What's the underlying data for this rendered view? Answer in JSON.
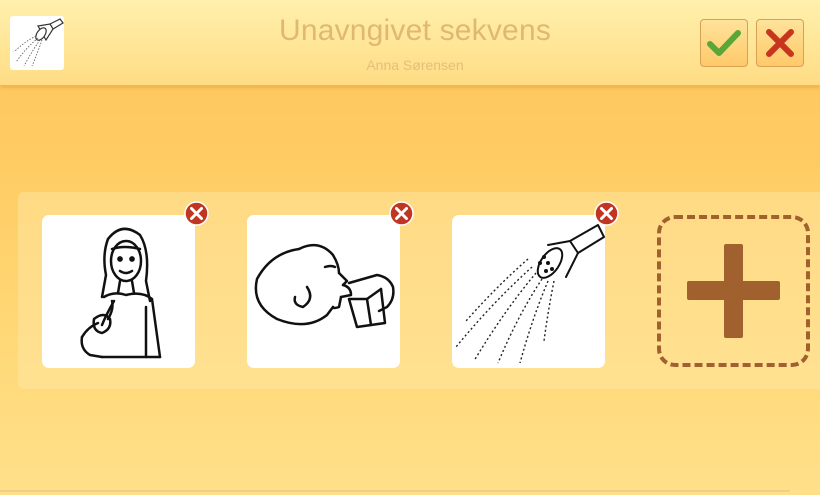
{
  "header": {
    "title": "Unavngivet sekvens",
    "subtitle": "Anna Sørensen",
    "sequence_icon": "shower-head-icon",
    "confirm_icon": "checkmark-icon",
    "cancel_icon": "close-icon"
  },
  "steps": [
    {
      "icon": "girl-pointing-icon",
      "remove_icon": "remove-icon"
    },
    {
      "icon": "boy-drinking-icon",
      "remove_icon": "remove-icon"
    },
    {
      "icon": "shower-head-icon",
      "remove_icon": "remove-icon"
    }
  ],
  "add_step": {
    "icon": "plus-icon"
  },
  "colors": {
    "accent_brown": "#a0612f",
    "confirm_green": "#5aa637",
    "cancel_red": "#c8351f",
    "title_color": "#e0b872"
  }
}
